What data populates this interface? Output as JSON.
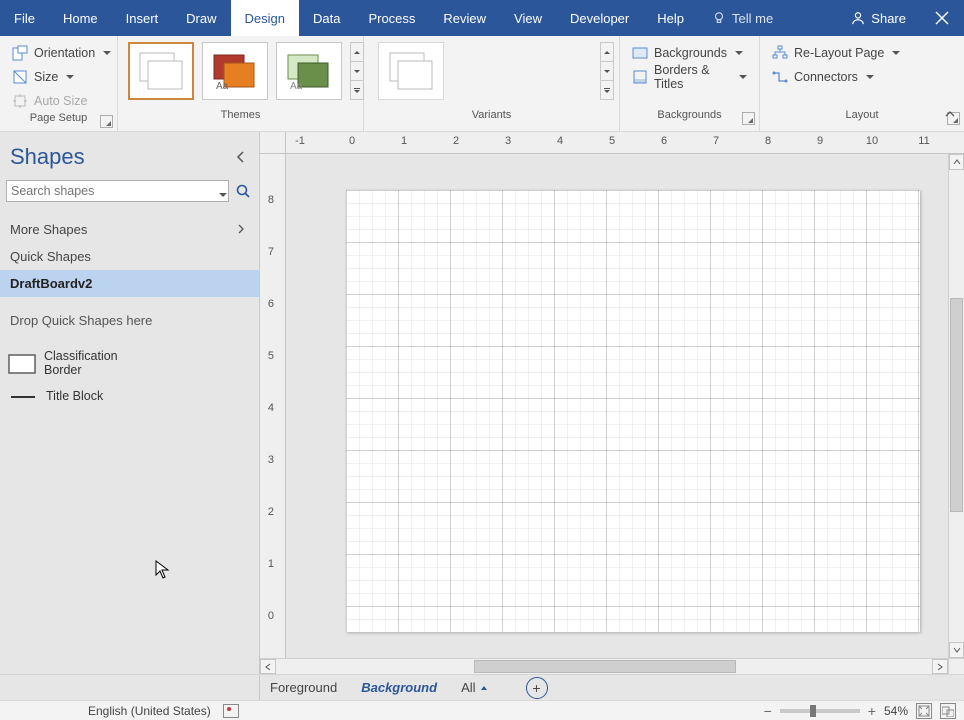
{
  "menubar": {
    "file": "File",
    "tabs": [
      "Home",
      "Insert",
      "Draw",
      "Design",
      "Data",
      "Process",
      "Review",
      "View",
      "Developer",
      "Help"
    ],
    "active_tab_index": 3,
    "tellme_placeholder": "Tell me",
    "share": "Share"
  },
  "ribbon": {
    "page_setup": {
      "orientation": "Orientation",
      "size": "Size",
      "auto_size": "Auto Size",
      "label": "Page Setup"
    },
    "themes": {
      "label": "Themes"
    },
    "variants": {
      "label": "Variants"
    },
    "backgrounds": {
      "backgrounds": "Backgrounds",
      "borders_titles": "Borders & Titles",
      "label": "Backgrounds"
    },
    "layout": {
      "relayout": "Re-Layout Page",
      "connectors": "Connectors",
      "label": "Layout"
    }
  },
  "shapes_pane": {
    "title": "Shapes",
    "search_placeholder": "Search shapes",
    "more_shapes": "More Shapes",
    "quick_shapes": "Quick Shapes",
    "selected_stencil": "DraftBoardv2",
    "drop_hint": "Drop Quick Shapes here",
    "items": {
      "classification_border": "Classification Border",
      "title_block": "Title Block"
    }
  },
  "pagetabs": {
    "foreground": "Foreground",
    "background": "Background",
    "all": "All"
  },
  "status": {
    "language": "English (United States)",
    "zoom_pct": "54%"
  },
  "ruler": {
    "h_labels": [
      "-1",
      "0",
      "1",
      "2",
      "3",
      "4",
      "5",
      "6",
      "7",
      "8",
      "9",
      "10",
      "11"
    ],
    "v_labels": [
      "8",
      "7",
      "6",
      "5",
      "4",
      "3",
      "2",
      "1",
      "0"
    ]
  }
}
